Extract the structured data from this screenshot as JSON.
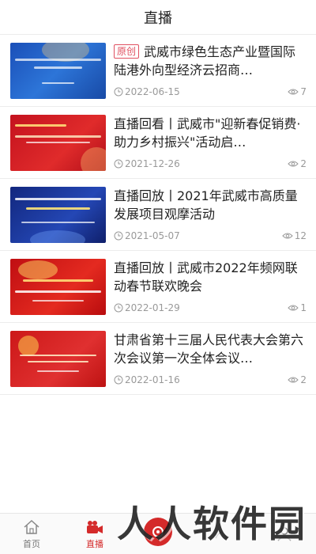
{
  "header": {
    "title": "直播"
  },
  "items": [
    {
      "tag": "原创",
      "title": "武威市绿色生态产业暨国际陆港外向型经济云招商…",
      "date": "2022-06-15",
      "views": "7"
    },
    {
      "tag": "",
      "title": "直播回看丨武威市\"迎新春促销费·助力乡村振兴\"活动启…",
      "date": "2021-12-26",
      "views": "2"
    },
    {
      "tag": "",
      "title": "直播回放丨2021年武威市高质量发展项目观摩活动",
      "date": "2021-05-07",
      "views": "12"
    },
    {
      "tag": "",
      "title": "直播回放丨武威市2022年频网联动春节联欢晚会",
      "date": "2022-01-29",
      "views": "1"
    },
    {
      "tag": "",
      "title": "甘肃省第十三届人民代表大会第六次会议第一次全体会议…",
      "date": "2022-01-16",
      "views": "2"
    }
  ],
  "tabbar": {
    "tabs": [
      {
        "label": "首页",
        "icon": "home-icon"
      },
      {
        "label": "直播",
        "icon": "video-camera-icon"
      },
      {
        "label": "",
        "icon": "center-logo-icon"
      },
      {
        "label": "",
        "icon": "service-icon"
      },
      {
        "label": "",
        "icon": "profile-icon"
      }
    ]
  },
  "watermark": "人人软件园",
  "colors": {
    "accent": "#d42a2a",
    "tag": "#e05060",
    "meta": "#999999"
  }
}
